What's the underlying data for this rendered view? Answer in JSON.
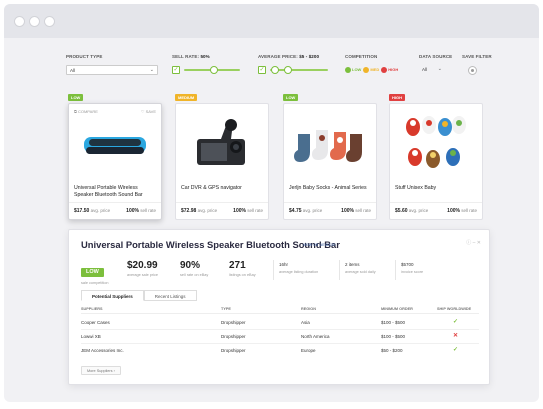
{
  "filters": {
    "product_type": {
      "label": "PRODUCT TYPE",
      "value": "All"
    },
    "sell_rate": {
      "label": "SELL RATE:",
      "value": "50%",
      "level_percent": 50
    },
    "average_price": {
      "label": "AVERAGE PRICE:",
      "value": "$5 - $200"
    },
    "competition": {
      "label": "COMPETITION",
      "options": [
        "LOW",
        "MED",
        "HIGH"
      ]
    },
    "data_source": {
      "label": "DATA SOURCE",
      "value": "All"
    },
    "save_filter_label": "SAVE FILTER"
  },
  "colors": {
    "low": "#7cbf3c",
    "med": "#f0b429",
    "high": "#e04040",
    "accent": "#7cbf3c"
  },
  "products": [
    {
      "badge": "LOW",
      "badge_color": "#7cbf3c",
      "title": "Universal Portable Wireless Speaker Bluetooth Sound Bar",
      "price": "$17.50",
      "price_label": "avg. price",
      "rate": "100%",
      "rate_label": "sell rate",
      "compare_label": "COMPARE",
      "save_label": "SAVE",
      "icon": "speaker-icon"
    },
    {
      "badge": "MEDIUM",
      "badge_color": "#f0b429",
      "title": "Car DVR & GPS navigator",
      "price": "$72.98",
      "price_label": "avg. price",
      "rate": "100%",
      "rate_label": "sell rate",
      "icon": "car-dvr-icon"
    },
    {
      "badge": "LOW",
      "badge_color": "#7cbf3c",
      "title": "Jerljn Baby Socks - Animal Series",
      "price": "$4.75",
      "price_label": "avg. price",
      "rate": "100%",
      "rate_label": "sell rate",
      "icon": "baby-socks-icon"
    },
    {
      "badge": "HIGH",
      "badge_color": "#e04040",
      "title": "Stuff Unisex Baby",
      "price": "$5.60",
      "price_label": "avg. price",
      "rate": "100%",
      "rate_label": "sell rate",
      "icon": "baby-shoes-icon"
    }
  ],
  "detail": {
    "title": "Universal Portable Wireless Speaker Bluetooth Sound Bar",
    "link": "view on amazon",
    "stats": [
      {
        "value": "LOW",
        "label": "sale competition"
      },
      {
        "value": "$20.99",
        "label": "average sale price"
      },
      {
        "value": "90%",
        "label": "sell rate on eBay"
      },
      {
        "value": "271",
        "label": "listings on eBay"
      }
    ],
    "small_stats": [
      {
        "value": "16hr",
        "label": "average listing duration"
      },
      {
        "value": "2 items",
        "label": "average sold daily"
      },
      {
        "value": "$5700",
        "label": "invoice score"
      }
    ],
    "tabs": [
      "Potential Suppliers",
      "Recent Listings"
    ],
    "columns": [
      "SUPPLIERS",
      "TYPE",
      "REGION",
      "MINIMUM ORDER",
      "SHIP WORLDWIDE"
    ],
    "rows": [
      {
        "supplier": "Cooper Cases",
        "type": "Dropshipper",
        "region": "Asia",
        "min_order": "$100 - $500",
        "ship": "✓"
      },
      {
        "supplier": "Lowwi XB",
        "type": "Dropshipper",
        "region": "North America",
        "min_order": "$100 - $500",
        "ship": "✕"
      },
      {
        "supplier": "JEM Accessories Inc.",
        "type": "Dropshipper",
        "region": "Europe",
        "min_order": "$50 - $200",
        "ship": "✓"
      }
    ],
    "more_label": "More Suppliers"
  }
}
